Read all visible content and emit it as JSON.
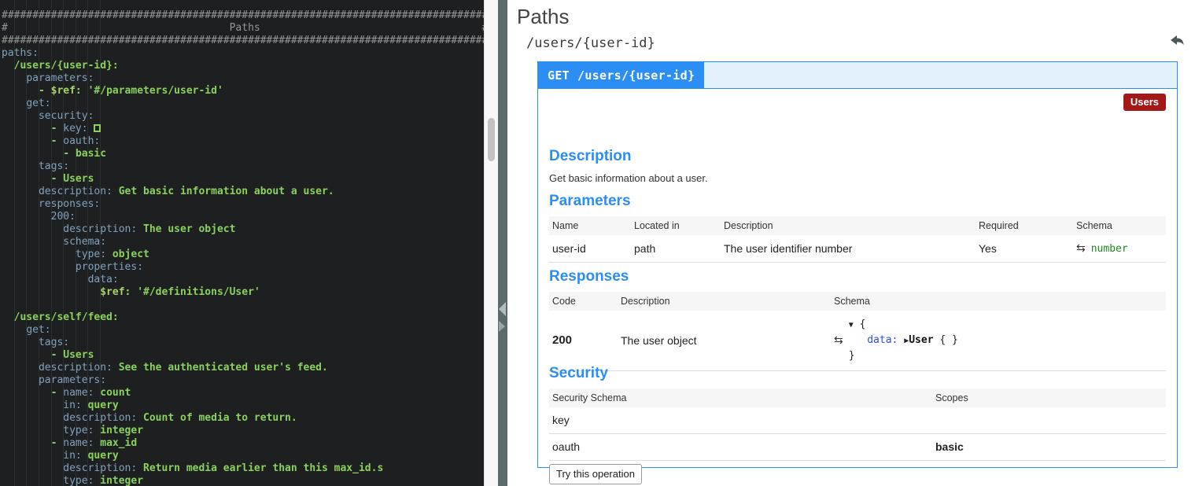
{
  "editor": {
    "banner": {
      "rule": "###############################################################################",
      "title": "Paths",
      "hash": "#"
    },
    "lines": [
      {
        "indent": 0,
        "parts": [
          {
            "t": "paths:",
            "c": "tok-key"
          }
        ]
      },
      {
        "indent": 1,
        "parts": [
          {
            "t": "/users/{user-id}:",
            "c": "tok-val"
          }
        ]
      },
      {
        "indent": 2,
        "parts": [
          {
            "t": "parameters:",
            "c": "tok-key"
          }
        ]
      },
      {
        "indent": 3,
        "parts": [
          {
            "t": "- ",
            "c": "tok-dash"
          },
          {
            "t": "$ref: ",
            "c": "tok-key2"
          },
          {
            "t": "'#/parameters/user-id'",
            "c": "tok-val"
          }
        ]
      },
      {
        "indent": 2,
        "parts": [
          {
            "t": "get:",
            "c": "tok-key"
          }
        ]
      },
      {
        "indent": 3,
        "parts": [
          {
            "t": "security:",
            "c": "tok-key"
          }
        ]
      },
      {
        "indent": 4,
        "parts": [
          {
            "t": "- ",
            "c": "tok-dash"
          },
          {
            "t": "key: ",
            "c": "tok-key"
          },
          {
            "t": "[]",
            "c": "box"
          }
        ]
      },
      {
        "indent": 4,
        "parts": [
          {
            "t": "- ",
            "c": "tok-dash"
          },
          {
            "t": "oauth:",
            "c": "tok-key"
          }
        ]
      },
      {
        "indent": 5,
        "parts": [
          {
            "t": "- ",
            "c": "tok-dash"
          },
          {
            "t": "basic",
            "c": "tok-val"
          }
        ]
      },
      {
        "indent": 3,
        "parts": [
          {
            "t": "tags:",
            "c": "tok-key"
          }
        ]
      },
      {
        "indent": 4,
        "parts": [
          {
            "t": "- ",
            "c": "tok-dash"
          },
          {
            "t": "Users",
            "c": "tok-val"
          }
        ]
      },
      {
        "indent": 3,
        "parts": [
          {
            "t": "description: ",
            "c": "tok-key"
          },
          {
            "t": "Get basic information about a user.",
            "c": "tok-val"
          }
        ]
      },
      {
        "indent": 3,
        "parts": [
          {
            "t": "responses:",
            "c": "tok-key"
          }
        ]
      },
      {
        "indent": 4,
        "parts": [
          {
            "t": "200:",
            "c": "tok-key"
          }
        ]
      },
      {
        "indent": 5,
        "parts": [
          {
            "t": "description: ",
            "c": "tok-key"
          },
          {
            "t": "The user object",
            "c": "tok-val"
          }
        ]
      },
      {
        "indent": 5,
        "parts": [
          {
            "t": "schema:",
            "c": "tok-key"
          }
        ]
      },
      {
        "indent": 6,
        "parts": [
          {
            "t": "type: ",
            "c": "tok-key"
          },
          {
            "t": "object",
            "c": "tok-val"
          }
        ]
      },
      {
        "indent": 6,
        "parts": [
          {
            "t": "properties:",
            "c": "tok-key"
          }
        ]
      },
      {
        "indent": 7,
        "parts": [
          {
            "t": "data:",
            "c": "tok-key"
          }
        ]
      },
      {
        "indent": 8,
        "parts": [
          {
            "t": "$ref: ",
            "c": "tok-key2"
          },
          {
            "t": "'#/definitions/User'",
            "c": "tok-val"
          }
        ]
      },
      {
        "indent": 0,
        "parts": []
      },
      {
        "indent": 1,
        "parts": [
          {
            "t": "/users/self/feed:",
            "c": "tok-val"
          }
        ]
      },
      {
        "indent": 2,
        "parts": [
          {
            "t": "get:",
            "c": "tok-key"
          }
        ]
      },
      {
        "indent": 3,
        "parts": [
          {
            "t": "tags:",
            "c": "tok-key"
          }
        ]
      },
      {
        "indent": 4,
        "parts": [
          {
            "t": "- ",
            "c": "tok-dash"
          },
          {
            "t": "Users",
            "c": "tok-val"
          }
        ]
      },
      {
        "indent": 3,
        "parts": [
          {
            "t": "description: ",
            "c": "tok-key"
          },
          {
            "t": "See the authenticated user's feed.",
            "c": "tok-val"
          }
        ]
      },
      {
        "indent": 3,
        "parts": [
          {
            "t": "parameters:",
            "c": "tok-key"
          }
        ]
      },
      {
        "indent": 4,
        "parts": [
          {
            "t": "- ",
            "c": "tok-dash"
          },
          {
            "t": "name: ",
            "c": "tok-key"
          },
          {
            "t": "count",
            "c": "tok-val"
          }
        ]
      },
      {
        "indent": 5,
        "parts": [
          {
            "t": "in: ",
            "c": "tok-key"
          },
          {
            "t": "query",
            "c": "tok-val"
          }
        ]
      },
      {
        "indent": 5,
        "parts": [
          {
            "t": "description: ",
            "c": "tok-key"
          },
          {
            "t": "Count of media to return.",
            "c": "tok-val"
          }
        ]
      },
      {
        "indent": 5,
        "parts": [
          {
            "t": "type: ",
            "c": "tok-key"
          },
          {
            "t": "integer",
            "c": "tok-val"
          }
        ]
      },
      {
        "indent": 4,
        "parts": [
          {
            "t": "- ",
            "c": "tok-dash"
          },
          {
            "t": "name: ",
            "c": "tok-key"
          },
          {
            "t": "max_id",
            "c": "tok-val"
          }
        ]
      },
      {
        "indent": 5,
        "parts": [
          {
            "t": "in: ",
            "c": "tok-key"
          },
          {
            "t": "query",
            "c": "tok-val"
          }
        ]
      },
      {
        "indent": 5,
        "parts": [
          {
            "t": "description: ",
            "c": "tok-key"
          },
          {
            "t": "Return media earlier than this max_id.s",
            "c": "tok-val"
          }
        ]
      },
      {
        "indent": 5,
        "parts": [
          {
            "t": "type: ",
            "c": "tok-key"
          },
          {
            "t": "integer",
            "c": "tok-val"
          }
        ]
      }
    ]
  },
  "docs": {
    "pane_title": "Paths",
    "path": "/users/{user-id}",
    "undo_icon": "undo-arrow-icon",
    "operation": {
      "method": "GET",
      "path": "/users/{user-id}",
      "tag": "Users"
    },
    "description": {
      "heading": "Description",
      "text": "Get basic information about a user."
    },
    "parameters": {
      "heading": "Parameters",
      "columns": [
        "Name",
        "Located in",
        "Description",
        "Required",
        "Schema"
      ],
      "rows": [
        {
          "name": "user-id",
          "located_in": "path",
          "description": "The user identifier number",
          "required": "Yes",
          "schema_icon": "swap-icon",
          "schema": "number"
        }
      ]
    },
    "responses": {
      "heading": "Responses",
      "columns": [
        "Code",
        "Description",
        "Schema"
      ],
      "rows": [
        {
          "code": "200",
          "description": "The user object",
          "schema_icon": "swap-icon",
          "schema_tree": {
            "open_caret": "▼",
            "open_brace": "{",
            "key": "data:",
            "child_caret": "▶",
            "child_type": "User",
            "child_braces": "{ }",
            "close_brace": "}"
          }
        }
      ]
    },
    "security": {
      "heading": "Security",
      "columns": [
        "Security Schema",
        "Scopes"
      ],
      "rows": [
        {
          "schema": "key",
          "scopes": ""
        },
        {
          "schema": "oauth",
          "scopes": "basic"
        }
      ]
    },
    "try_button": "Try this operation"
  },
  "colors": {
    "accent_blue": "#2a8ef4",
    "tag_red": "#a51818",
    "code_green": "#1aa11a",
    "editor_bg": "#1d1f21"
  }
}
